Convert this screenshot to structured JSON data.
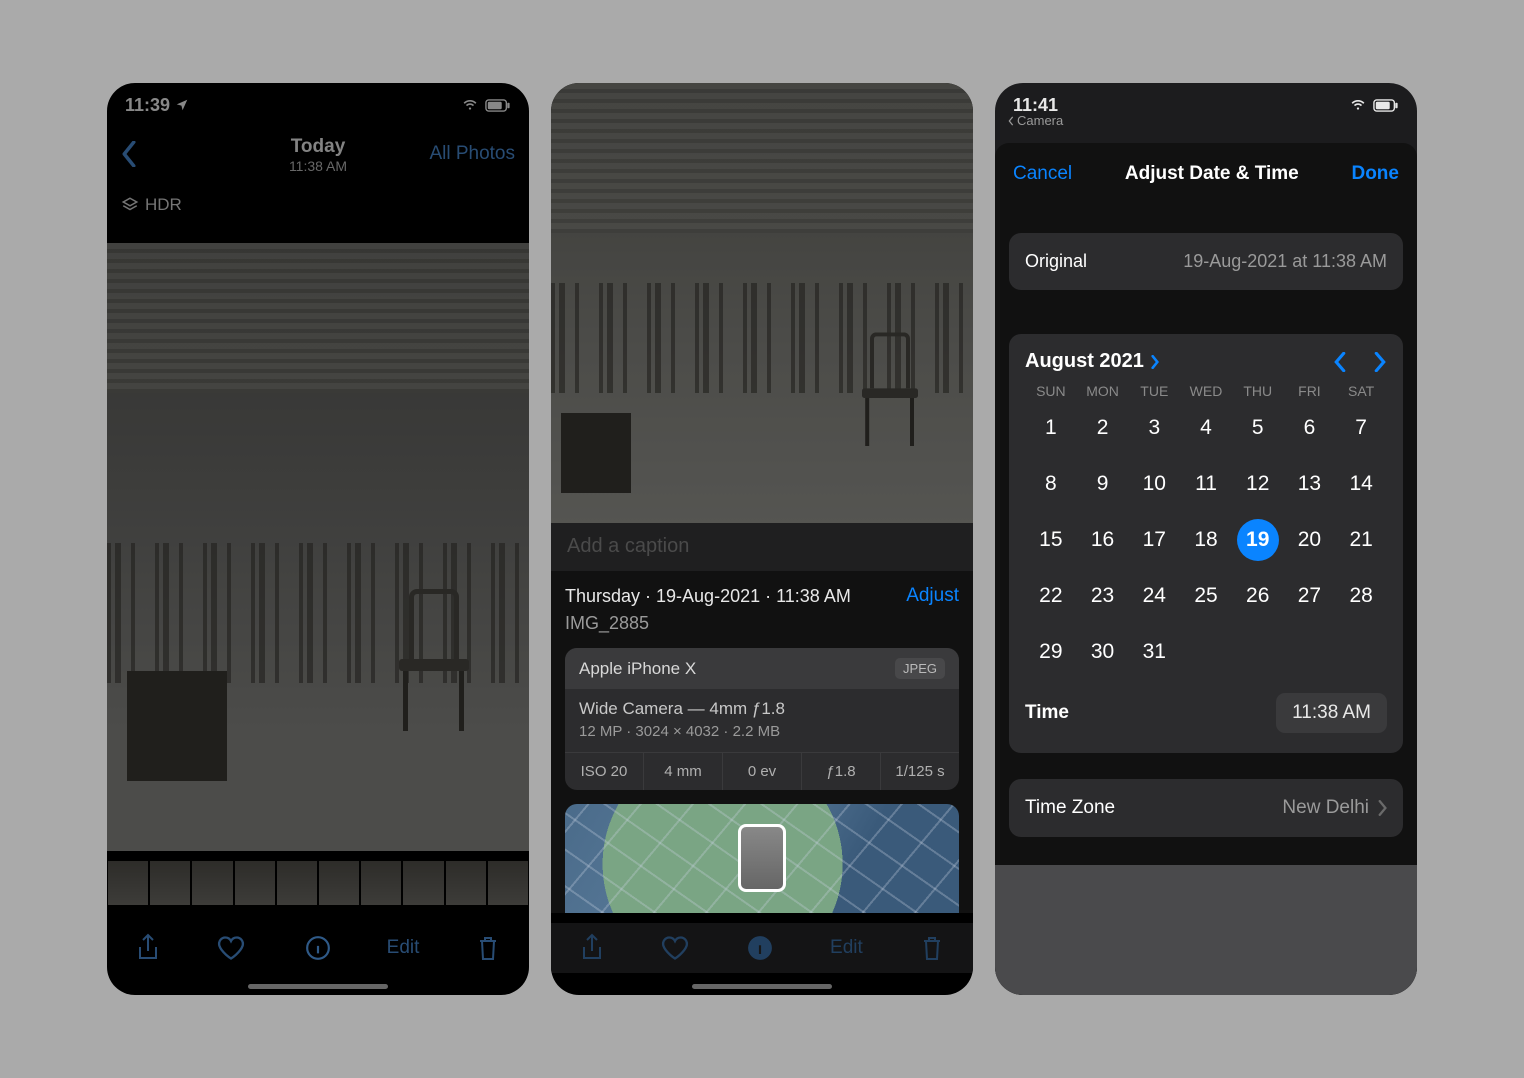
{
  "screen1": {
    "status": {
      "time": "11:39"
    },
    "header": {
      "title": "Today",
      "subtitle": "11:38 AM",
      "right": "All Photos"
    },
    "hdr_badge": "HDR",
    "toolbar": {
      "edit": "Edit"
    }
  },
  "screen2": {
    "caption_placeholder": "Add a caption",
    "info": {
      "date_line": "Thursday · 19-Aug-2021 · 11:38 AM",
      "adjust": "Adjust",
      "filename": "IMG_2885",
      "device": "Apple iPhone X",
      "format": "JPEG",
      "lens": "Wide Camera — 4mm ƒ1.8",
      "specs": "12 MP  ·  3024 × 4032  ·  2.2 MB",
      "strip": [
        "ISO 20",
        "4 mm",
        "0 ev",
        "ƒ1.8",
        "1/125 s"
      ]
    },
    "toolbar": {
      "edit": "Edit"
    }
  },
  "screen3": {
    "status": {
      "time": "11:41"
    },
    "breadcrumb": "Camera",
    "sheet": {
      "cancel": "Cancel",
      "title": "Adjust Date & Time",
      "done": "Done",
      "original_label": "Original",
      "original_value": "19-Aug-2021 at 11:38 AM",
      "month": "August 2021",
      "dow": [
        "SUN",
        "MON",
        "TUE",
        "WED",
        "THU",
        "FRI",
        "SAT"
      ],
      "days": [
        1,
        2,
        3,
        4,
        5,
        6,
        7,
        8,
        9,
        10,
        11,
        12,
        13,
        14,
        15,
        16,
        17,
        18,
        19,
        20,
        21,
        22,
        23,
        24,
        25,
        26,
        27,
        28,
        29,
        30,
        31
      ],
      "selected_day": 19,
      "time_label": "Time",
      "time_value": "11:38 AM",
      "tz_label": "Time Zone",
      "tz_value": "New Delhi"
    }
  }
}
